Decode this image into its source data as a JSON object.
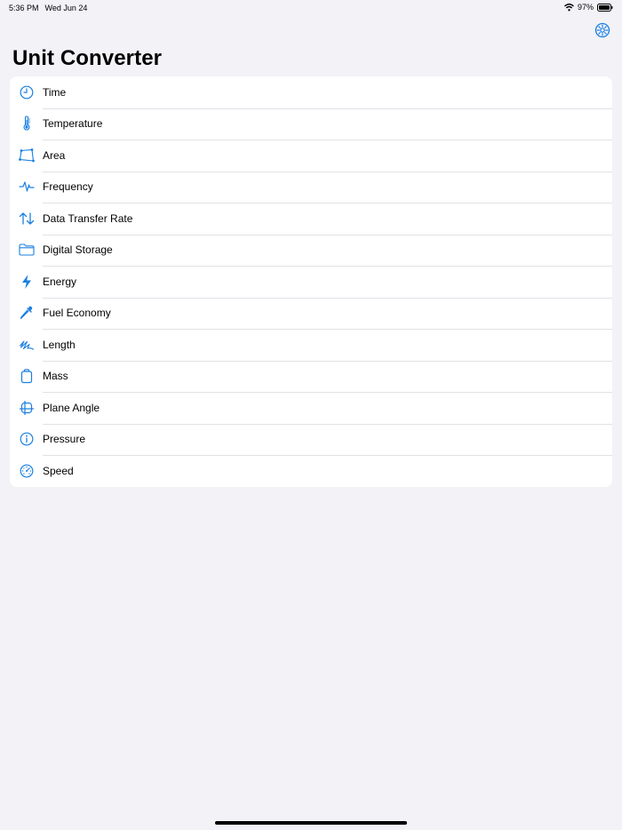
{
  "status_bar": {
    "time": "5:36 PM",
    "date": "Wed Jun 24",
    "battery": "97%"
  },
  "header": {
    "title": "Unit Converter",
    "settings_icon": "gear-icon"
  },
  "accent_color": "#1a7fe0",
  "categories": [
    {
      "label": "Time",
      "icon": "clock-icon"
    },
    {
      "label": "Temperature",
      "icon": "thermometer-icon"
    },
    {
      "label": "Area",
      "icon": "polygon-icon"
    },
    {
      "label": "Frequency",
      "icon": "waveform-icon"
    },
    {
      "label": "Data Transfer Rate",
      "icon": "arrows-up-down-icon"
    },
    {
      "label": "Digital Storage",
      "icon": "folder-icon"
    },
    {
      "label": "Energy",
      "icon": "lightning-icon"
    },
    {
      "label": "Fuel Economy",
      "icon": "eyedropper-icon"
    },
    {
      "label": "Length",
      "icon": "scribble-icon"
    },
    {
      "label": "Mass",
      "icon": "bag-icon"
    },
    {
      "label": "Plane Angle",
      "icon": "grid-angle-icon"
    },
    {
      "label": "Pressure",
      "icon": "gauge-icon"
    },
    {
      "label": "Speed",
      "icon": "speedometer-icon"
    }
  ]
}
